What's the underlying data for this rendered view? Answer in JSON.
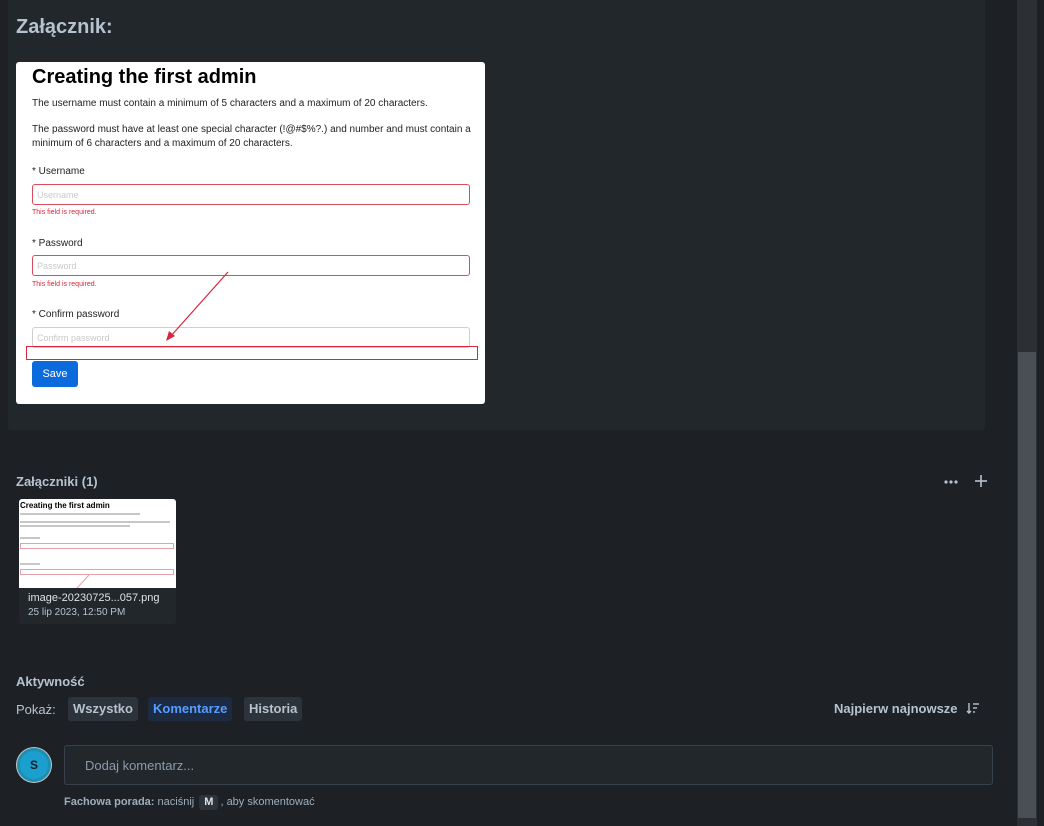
{
  "description": {
    "attachment_heading": "Załącznik:",
    "embed": {
      "title": "Creating the first admin",
      "paragraph1": "The username must contain a minimum of 5 characters and a maximum of 20 characters.",
      "paragraph2": "The password must have at least one special character (!@#$%?.) and number and must contain a minimum of 6 characters and a maximum of 20 characters.",
      "username_label": "* Username",
      "username_placeholder": "Username",
      "username_error": "This field is required.",
      "password_label": "* Password",
      "password_placeholder": "Password",
      "password_error": "This field is required.",
      "confirm_label": "* Confirm password",
      "confirm_placeholder": "Confirm password",
      "save_label": "Save"
    }
  },
  "attachments": {
    "title": "Załączniki (1)",
    "more_icon": "more-horizontal-icon",
    "add_icon": "plus-icon",
    "items": [
      {
        "thumb_title": "Creating the first admin",
        "filename": "image-20230725...057.png",
        "date": "25 lip 2023, 12:50 PM"
      }
    ]
  },
  "activity": {
    "title": "Aktywność",
    "show_label": "Pokaż:",
    "filters": {
      "all": "Wszystko",
      "comments": "Komentarze",
      "history": "Historia"
    },
    "active_filter": "comments",
    "sort_label": "Najpierw najnowsze",
    "sort_icon": "sort-descending-icon"
  },
  "comment": {
    "avatar_initial": "S",
    "placeholder": "Dodaj komentarz...",
    "tip_bold": "Fachowa porada:",
    "tip_pre": "naciśnij",
    "tip_key": "M",
    "tip_post": ", aby skomentować"
  },
  "colors": {
    "background": "#1d2125",
    "panel": "#22272b",
    "accent": "#579dff",
    "error": "#d9253a",
    "save_button": "#0b6bdc"
  }
}
